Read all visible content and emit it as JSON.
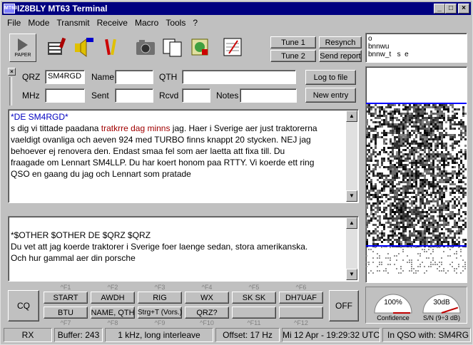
{
  "window": {
    "title": "IZ8BLY MT63 Terminal",
    "icon_label": "MT63"
  },
  "menu": [
    "File",
    "Mode",
    "Transmit",
    "Receive",
    "Macro",
    "Tools",
    "?"
  ],
  "toolbar": {
    "paper_label": "PAPER",
    "tune1": "Tune 1",
    "tune2": "Tune 2",
    "resynch": "Resynch",
    "send_report": "Send report"
  },
  "callsign_list": [
    "o",
    "bnnwu",
    "bnnw_t   s  e"
  ],
  "log": {
    "qrz_label": "QRZ",
    "qrz_value": "SM4RGD",
    "name_label": "Name",
    "name_value": "",
    "qth_label": "QTH",
    "qth_value": "",
    "mhz_label": "MHz",
    "mhz_value": "",
    "sent_label": "Sent",
    "sent_value": "",
    "rcvd_label": "Rcvd",
    "rcvd_value": "",
    "notes_label": "Notes",
    "notes_value": "",
    "log_to_file": "Log to file",
    "new_entry": "New entry"
  },
  "rx_text": {
    "line1": "*DE SM4RGD*",
    "line2a": "s dig vi tittade paadana ",
    "line2b": "tratkrre dag minns",
    "line2c": " jag. Haer i Sverige aer just traktorerna",
    "line3": "vaeldigt ovanliga och aeven 924 med TURBO finns knappt 20 stycken. NEJ jag",
    "line4": "behoever ej renovera den. Endast smaa fel som aer laetta att fixa till.  Du",
    "line5": "fraagade om Lennart SM4LLP. Du har koert honom paa RTTY. Vi koerde ett ring",
    "line6": "QSO en gaang du jag och Lennart som pratade"
  },
  "tx_text": {
    "line1": "*$OTHER $OTHER DE $QRZ  $QRZ",
    "line2": "Du vet att jag koerde traktorer i Sverige foer laenge sedan, stora amerikanska.",
    "line3": "Och hur gammal aer din porsche"
  },
  "macros": {
    "cq": "CQ",
    "off": "OFF",
    "top": [
      "START",
      "AWDH",
      "RIG",
      "WX",
      "SK SK",
      "DH7UAF"
    ],
    "bottom": [
      "BTU",
      "NAME, QTH",
      "Strg+T (Vors.)",
      "QRZ?",
      "",
      ""
    ],
    "fkeys_top": [
      "^F1",
      "^F2",
      "^F3",
      "^F4",
      "^F5",
      "^F6"
    ],
    "fkeys_bottom": [
      "^F7",
      "^F8",
      "^F9",
      "^F10",
      "^F11",
      "^F12"
    ]
  },
  "gauges": {
    "confidence_value": "100%",
    "confidence_label": "Confidence",
    "confidence_level": 1.0,
    "sn_value": "30dB",
    "sn_label": "S/N (9÷3 dB)",
    "sn_level": 0.9
  },
  "status": {
    "mode": "RX",
    "buffer": "Buffer: 243",
    "setting": "1 kHz, long interleave",
    "offset": "Offset: 17 Hz",
    "datetime": "Mi 12 Apr - 19:29:32 UTC",
    "qso": "In QSO with: SM4RG"
  },
  "colors": {
    "title_bg": "#000080",
    "face": "#c0c0c0",
    "rx_callsign": "#0000c0",
    "rx_error": "#a00000",
    "waterfall_line": "#0000ff"
  }
}
